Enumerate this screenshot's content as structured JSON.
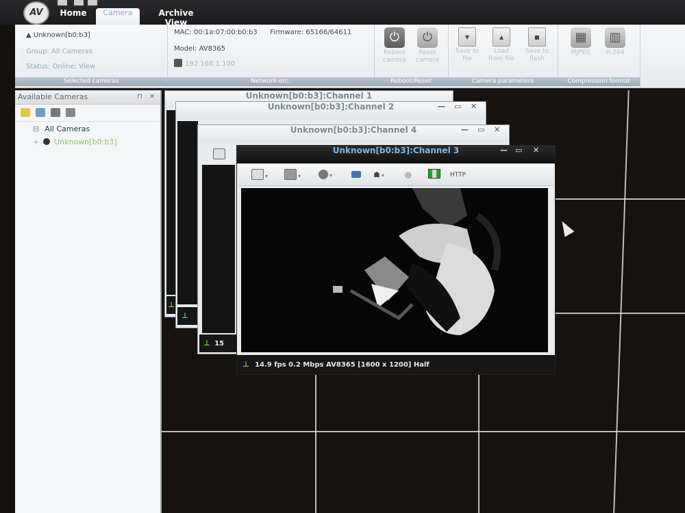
{
  "app": {
    "tabs": [
      "Home",
      "Camera",
      "Archive View"
    ],
    "active_tab": "Camera"
  },
  "ribbon": {
    "selected_cameras": {
      "name": "Unknown[b0:b3]",
      "group": "Group: All Cameras",
      "status": "Status: Online; View",
      "label": "Selected cameras"
    },
    "network": {
      "mac": "MAC: 00:1a:07:00:b0:b3",
      "firmware": "Firmware: 65166/64611",
      "model": "Model: AV8365",
      "ip": "192.168.1.100",
      "label": "Network etc."
    },
    "reboot": {
      "buttons": [
        {
          "label": "Reboot camera",
          "icon": "power-icon"
        },
        {
          "label": "Reset camera",
          "icon": "reset-icon"
        }
      ],
      "label": "Reboot/Reset"
    },
    "camera_params": {
      "buttons": [
        {
          "label": "Save to file",
          "icon": "save-icon"
        },
        {
          "label": "Load from file",
          "icon": "load-icon"
        },
        {
          "label": "Save to flash",
          "icon": "flash-icon"
        }
      ],
      "label": "Camera parameters"
    },
    "compression": {
      "buttons": [
        {
          "label": "MJPEG",
          "icon": "mjpeg-icon"
        },
        {
          "label": "H.264",
          "icon": "h264-icon"
        }
      ],
      "label": "Compression format"
    }
  },
  "left_panel": {
    "title": "Available Cameras",
    "tree_root": "All Cameras",
    "tree_camera": "Unknown[b0:b3]"
  },
  "windows": [
    {
      "title": "Unknown[b0:b3]:Channel 1"
    },
    {
      "title": "Unknown[b0:b3]:Channel 2"
    },
    {
      "title": "Unknown[b0:b3]:Channel 4",
      "status": "15"
    },
    {
      "title": "Unknown[b0:b3]:Channel 3",
      "status": "14.9 fps 0.2 Mbps AV8365 [1600 x 1200] Half",
      "toolbar_http": "HTTP"
    }
  ],
  "colors": {
    "wall_bg": "#15120f",
    "active_title": "#7fb8e6",
    "online_green": "#6ad04a"
  }
}
